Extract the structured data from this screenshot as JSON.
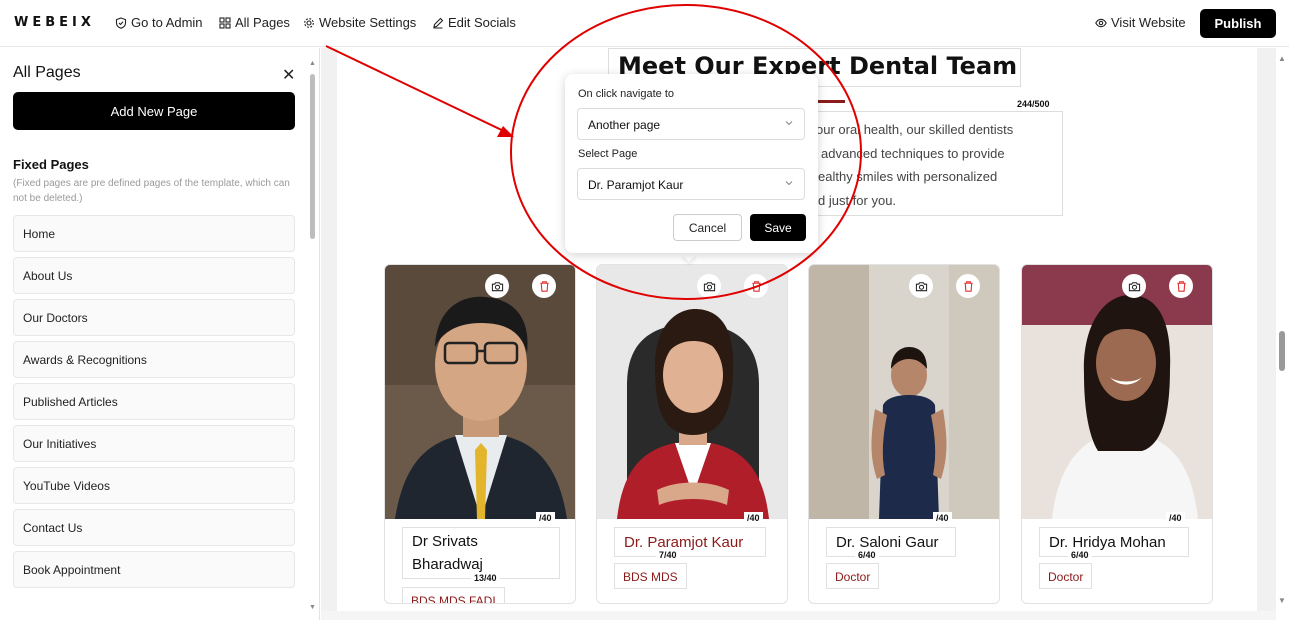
{
  "topbar": {
    "logo": "WEBEIX",
    "links": {
      "go_to_admin": "Go to Admin",
      "all_pages": "All Pages",
      "website_settings": "Website Settings",
      "edit_socials": "Edit Socials",
      "visit_website": "Visit Website"
    },
    "publish": "Publish"
  },
  "sidebar": {
    "title": "All Pages",
    "add_new_page": "Add New Page",
    "fixed_title": "Fixed Pages",
    "fixed_note": "(Fixed pages are pre defined pages of the template, which can not be deleted.)",
    "pages": [
      "Home",
      "About Us",
      "Our Doctors",
      "Awards & Recognitions",
      "Published Articles",
      "Our Initiatives",
      "YouTube Videos",
      "Contact Us",
      "Book Appointment"
    ]
  },
  "section": {
    "heading": "Meet Our Expert Dental Team",
    "para_counter": "244/500",
    "para_lines": [
      "our oral health, our skilled dentists",
      "advanced techniques to provide",
      "ealthy smiles with personalized",
      "d just for you."
    ]
  },
  "modal": {
    "navigate_label": "On click navigate to",
    "navigate_value": "Another page",
    "select_page_label": "Select Page",
    "select_page_value": "Dr. Paramjot Kaur",
    "cancel": "Cancel",
    "save": "Save"
  },
  "doctors": [
    {
      "name": "Dr Srivats Bharadwaj",
      "name_line1": "Dr Srivats",
      "name_line2": "Bharadwaj",
      "name_counter": "/40",
      "tag": "BDS MDS FADI",
      "tag_counter": "13/40"
    },
    {
      "name": "Dr. Paramjot Kaur",
      "name_counter": "/40",
      "tag": "BDS MDS",
      "tag_counter": "7/40"
    },
    {
      "name": "Dr. Saloni Gaur",
      "name_counter": "/40",
      "tag": "Doctor",
      "tag_counter": "6/40"
    },
    {
      "name": "Dr. Hridya Mohan",
      "name_counter": "/40",
      "tag": "Doctor",
      "tag_counter": "6/40"
    }
  ],
  "colors": {
    "accent_red": "#8b1a1a",
    "annotation_red": "#e00000",
    "publish_bg": "#000000"
  }
}
